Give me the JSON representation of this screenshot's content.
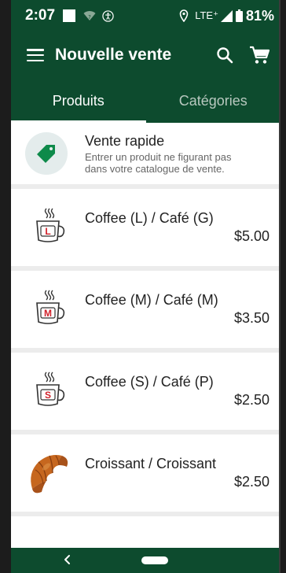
{
  "status_bar": {
    "time": "2:07",
    "network": "LTE⁺",
    "battery": "81%"
  },
  "app_bar": {
    "title": "Nouvelle vente"
  },
  "tabs": [
    {
      "label": "Produits",
      "active": true
    },
    {
      "label": "Catégories",
      "active": false
    }
  ],
  "quick_sale": {
    "title": "Vente rapide",
    "subtitle_line1": "Entrer un produit ne figurant pas",
    "subtitle_line2": "dans votre catalogue de vente."
  },
  "products": [
    {
      "name": "Coffee (L) / Café (G)",
      "price": "$5.00",
      "size_letter": "L",
      "icon": "coffee-cup-icon"
    },
    {
      "name": "Coffee (M) /  Café (M)",
      "price": "$3.50",
      "size_letter": "M",
      "icon": "coffee-cup-icon"
    },
    {
      "name": "Coffee (S) /  Café (P)",
      "price": "$2.50",
      "size_letter": "S",
      "icon": "coffee-cup-icon"
    },
    {
      "name": "Croissant / Croissant",
      "price": "$2.50",
      "icon": "croissant-icon"
    }
  ],
  "colors": {
    "brand": "#0d4b2e",
    "tag": "#0e8a4a",
    "cup_letter": "#d0202a"
  }
}
